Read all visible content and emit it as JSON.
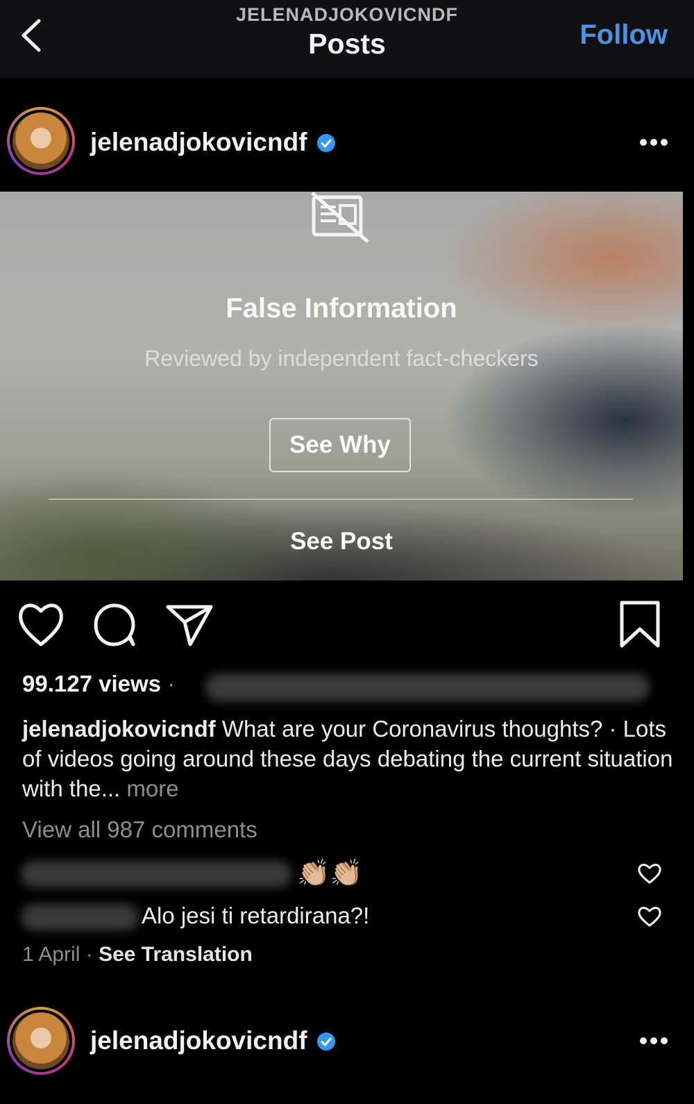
{
  "header": {
    "username": "JELENADJOKOVICNDF",
    "title": "Posts",
    "follow_label": "Follow"
  },
  "post": {
    "username": "jelenadjokovicndf",
    "overlay": {
      "title": "False Information",
      "subtitle": "Reviewed by independent fact-checkers",
      "see_why_label": "See Why",
      "see_post_label": "See Post"
    },
    "views": "99.127 views",
    "views_separator": "·",
    "caption_user": "jelenadjokovicndf",
    "caption_text": " What are your Coronavirus thoughts? · Lots of videos going around these days debating the current situation with the...",
    "caption_more": " more",
    "view_all_comments": "View all 987 comments",
    "comments": [
      {
        "text": "👏🏼👏🏼"
      },
      {
        "text": "Alo jesi ti retardirana?!"
      }
    ],
    "date": "1 April",
    "meta_separator": " · ",
    "see_translation": "See Translation"
  },
  "next_post": {
    "username": "jelenadjokovicndf"
  },
  "colors": {
    "background": "#000000",
    "accent_blue": "#4c93e6",
    "muted_text": "#8e8e8e",
    "verified_blue": "#3897f0"
  },
  "icons": {
    "back": "chevron-left-icon",
    "verified": "verified-badge-icon",
    "more": "more-dots-icon",
    "fact_check": "fact-check-icon",
    "like": "heart-icon",
    "comment": "comment-icon",
    "share": "share-icon",
    "save": "bookmark-icon"
  }
}
